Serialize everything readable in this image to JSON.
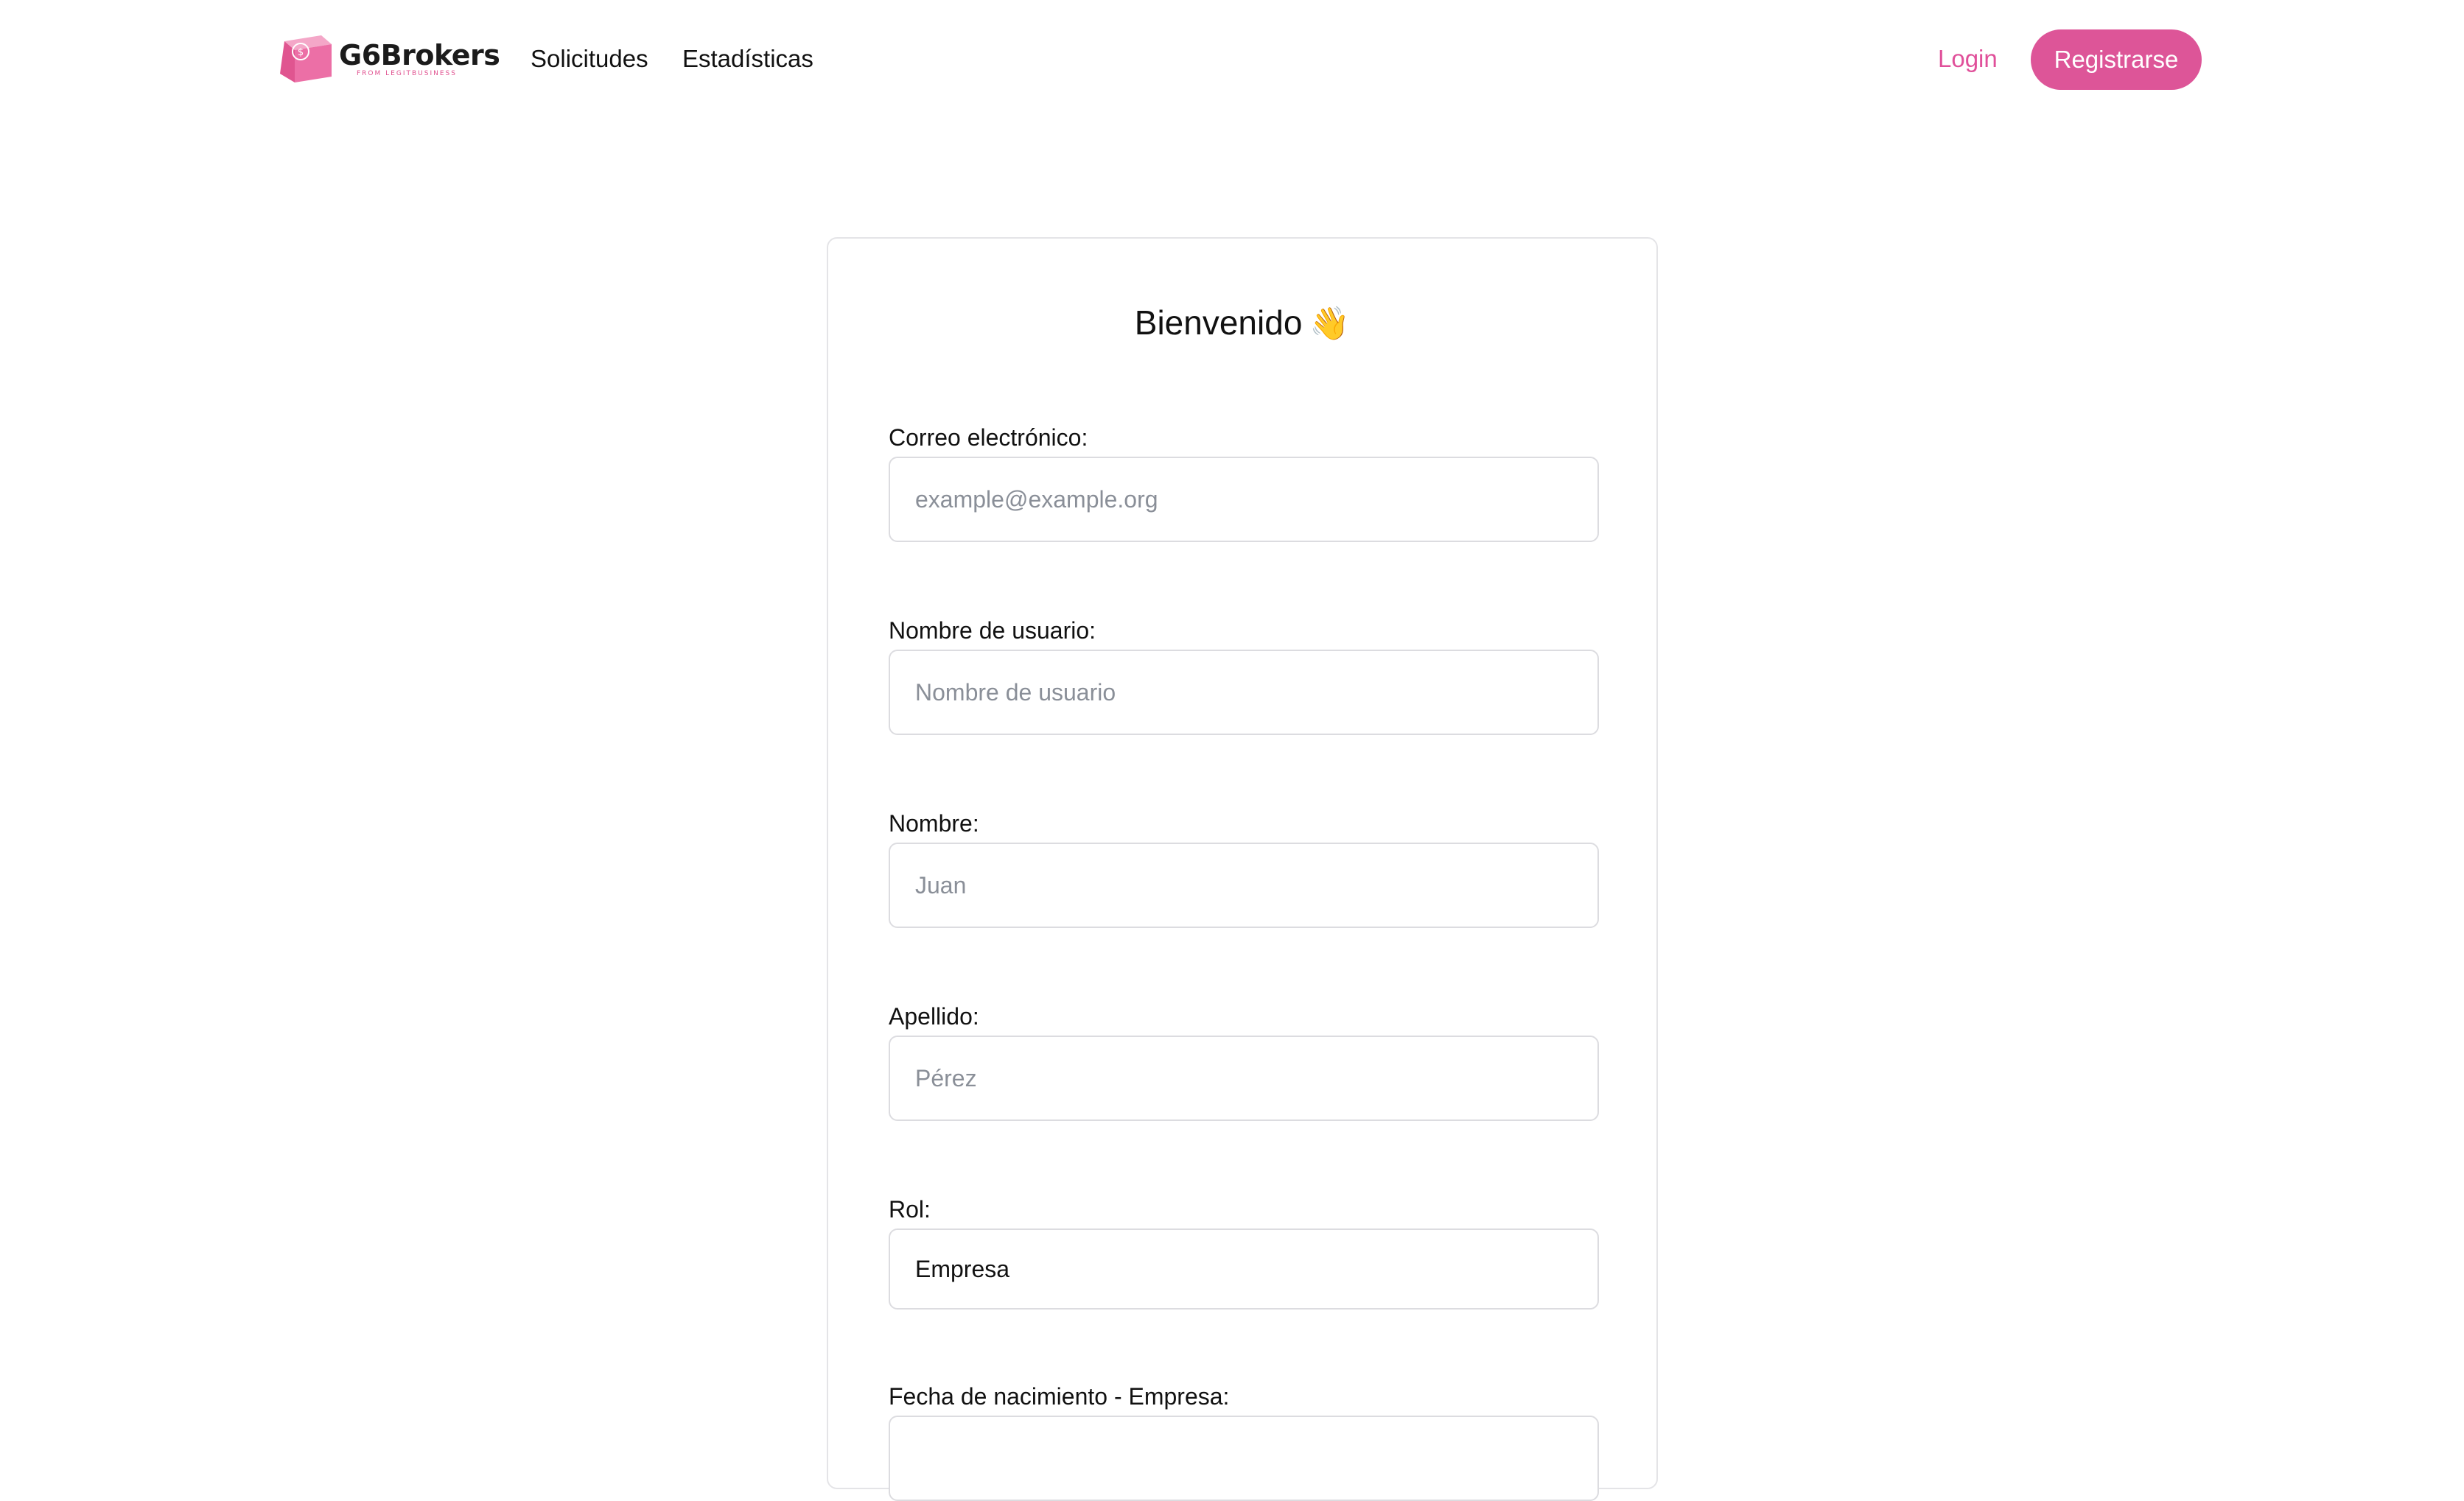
{
  "header": {
    "brand_name": "G6Brokers",
    "brand_sub": "FROM LEGITBUSINESS",
    "nav": [
      {
        "label": "Solicitudes"
      },
      {
        "label": "Estadísticas"
      }
    ],
    "login_label": "Login",
    "register_label": "Registrarse"
  },
  "form": {
    "title": "Bienvenido",
    "title_emoji": "👋",
    "fields": [
      {
        "label": "Correo electrónico:",
        "placeholder": "example@example.org",
        "value": ""
      },
      {
        "label": "Nombre de usuario:",
        "placeholder": "Nombre de usuario",
        "value": ""
      },
      {
        "label": "Nombre:",
        "placeholder": "Juan",
        "value": ""
      },
      {
        "label": "Apellido:",
        "placeholder": "Pérez",
        "value": ""
      },
      {
        "label": "Rol:",
        "placeholder": "",
        "value": "Empresa"
      },
      {
        "label": "Fecha de nacimiento - Empresa:",
        "placeholder": "",
        "value": ""
      }
    ]
  },
  "colors": {
    "accent": "#dd5598",
    "login": "#e0509a",
    "border": "#dcdce0"
  }
}
